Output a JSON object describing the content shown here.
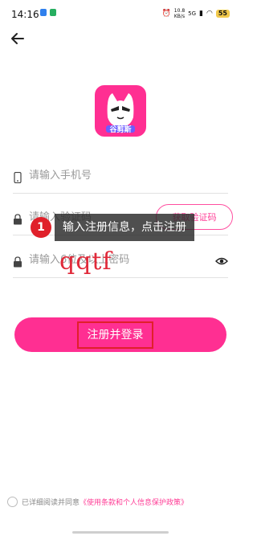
{
  "status_bar": {
    "time": "14:16",
    "net_speed_value": "10.8",
    "net_speed_unit": "KB/s",
    "network_type": "5G",
    "battery": "55",
    "icons": [
      "notification-icon",
      "app-icon",
      "alarm-icon",
      "signal-icon",
      "wifi-icon",
      "battery-icon"
    ]
  },
  "app": {
    "logo_text": "谷剪斯",
    "brand_color": "#ff2f92"
  },
  "form": {
    "phone_placeholder": "请输入手机号",
    "code_placeholder": "请输入验证码",
    "code_button_label": "获取验证码",
    "password_placeholder": "请输入6位及以上密码",
    "submit_label": "注册并登录"
  },
  "overlay": {
    "step_number": "1",
    "hint_text": "输入注册信息，点击注册",
    "handwriting": "qqtf"
  },
  "agreement": {
    "prefix": "已详细阅读并同意",
    "link_text": "《使用条款和个人信息保护政策》"
  }
}
